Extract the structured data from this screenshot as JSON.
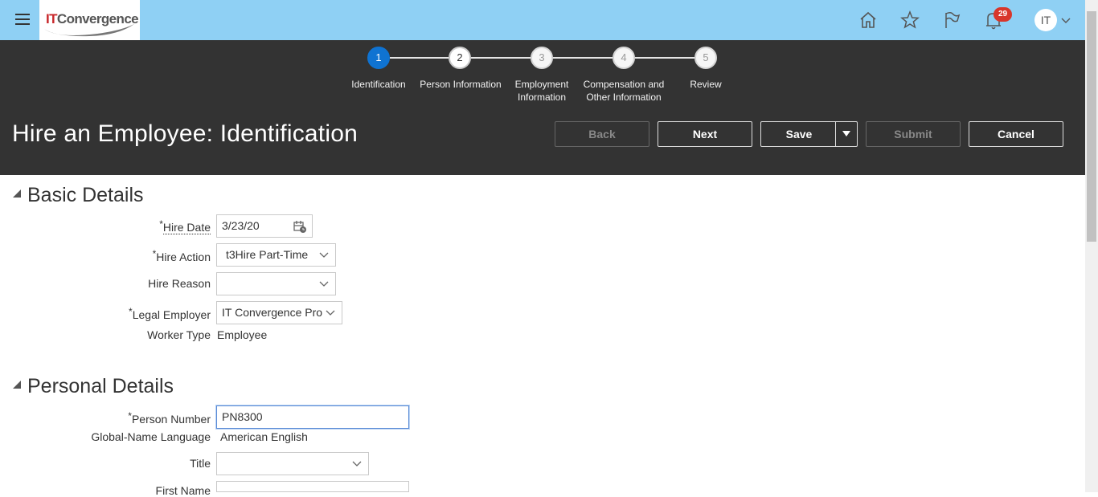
{
  "header": {
    "logo_text_it": "IT",
    "logo_text_conv": "Convergence",
    "notification_count": "29",
    "user_initials": "IT",
    "icons": [
      "menu-icon",
      "home-icon",
      "star-icon",
      "flag-icon",
      "bell-icon",
      "chevron-down-icon"
    ]
  },
  "train": {
    "steps": [
      {
        "num": "1",
        "label": "Identification",
        "state": "active"
      },
      {
        "num": "2",
        "label": "Person Information",
        "state": "visited"
      },
      {
        "num": "3",
        "label": "Employment Information",
        "state": "future"
      },
      {
        "num": "4",
        "label": "Compensation and Other Information",
        "state": "future"
      },
      {
        "num": "5",
        "label": "Review",
        "state": "future"
      }
    ]
  },
  "page": {
    "title": "Hire an Employee: Identification"
  },
  "actions": {
    "back": "Back",
    "next": "Next",
    "save": "Save",
    "submit": "Submit",
    "cancel": "Cancel"
  },
  "basic_details": {
    "heading": "Basic Details",
    "hire_date_label": "Hire Date",
    "hire_date_value": "3/23/20",
    "hire_action_label": "Hire Action",
    "hire_action_value": "t3Hire Part-Time",
    "hire_reason_label": "Hire Reason",
    "hire_reason_value": "",
    "legal_employer_label": "Legal Employer",
    "legal_employer_value": "IT Convergence Pro",
    "worker_type_label": "Worker Type",
    "worker_type_value": "Employee"
  },
  "personal_details": {
    "heading": "Personal Details",
    "person_number_label": "Person Number",
    "person_number_value": "PN8300",
    "global_name_language_label": "Global-Name Language",
    "global_name_language_value": "American English",
    "title_label": "Title",
    "title_value": "",
    "first_name_label": "First Name",
    "first_name_value": ""
  },
  "colors": {
    "header_bg": "#8fd0f4",
    "band_bg": "#333333",
    "active_step": "#0f73d2",
    "badge": "#d8362b"
  }
}
